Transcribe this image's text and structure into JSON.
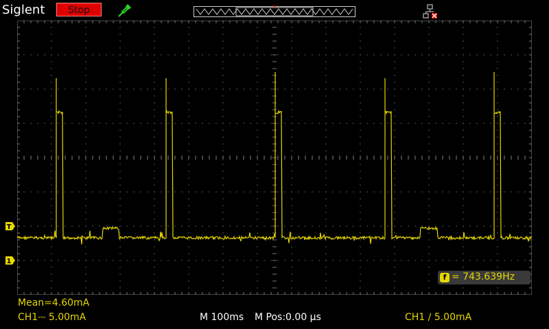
{
  "header": {
    "brand": "Siglent",
    "run_state": "Stop",
    "run_state_color": "#e00000"
  },
  "icons": {
    "probe": "probe-icon",
    "memory_bar": "memory-position-bar",
    "network": "network-status-icon"
  },
  "markers": {
    "trigger_top": "T",
    "trigger_level": "T",
    "channel1": "1"
  },
  "measurements": {
    "mean_label": "Mean=4.60mA",
    "frequency_badge": "f",
    "frequency_value": "= 743.639Hz"
  },
  "status": {
    "ch1_scale": "CH1⎓ 5.00mA",
    "timebase": "M 100ms",
    "time_position": "M Pos:0.00 µs",
    "trigger_info": "CH1 ∕ 5.00mA"
  },
  "colors": {
    "trace": "#e6d800",
    "grid": "#7a7a7a",
    "background": "#000000"
  }
}
